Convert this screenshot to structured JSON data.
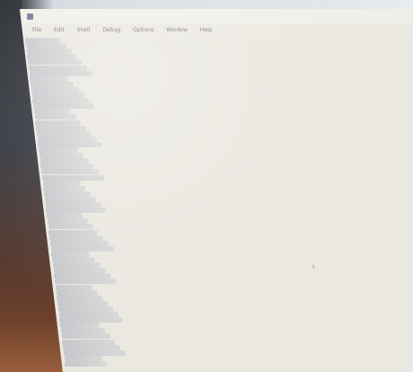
{
  "window": {
    "title": "",
    "icon": "app-icon"
  },
  "menu": {
    "items": [
      "File",
      "Edit",
      "Shell",
      "Debug",
      "Options",
      "Window",
      "Help"
    ]
  },
  "editor": {
    "line_count": 60,
    "cursor_glyph": "ı"
  }
}
